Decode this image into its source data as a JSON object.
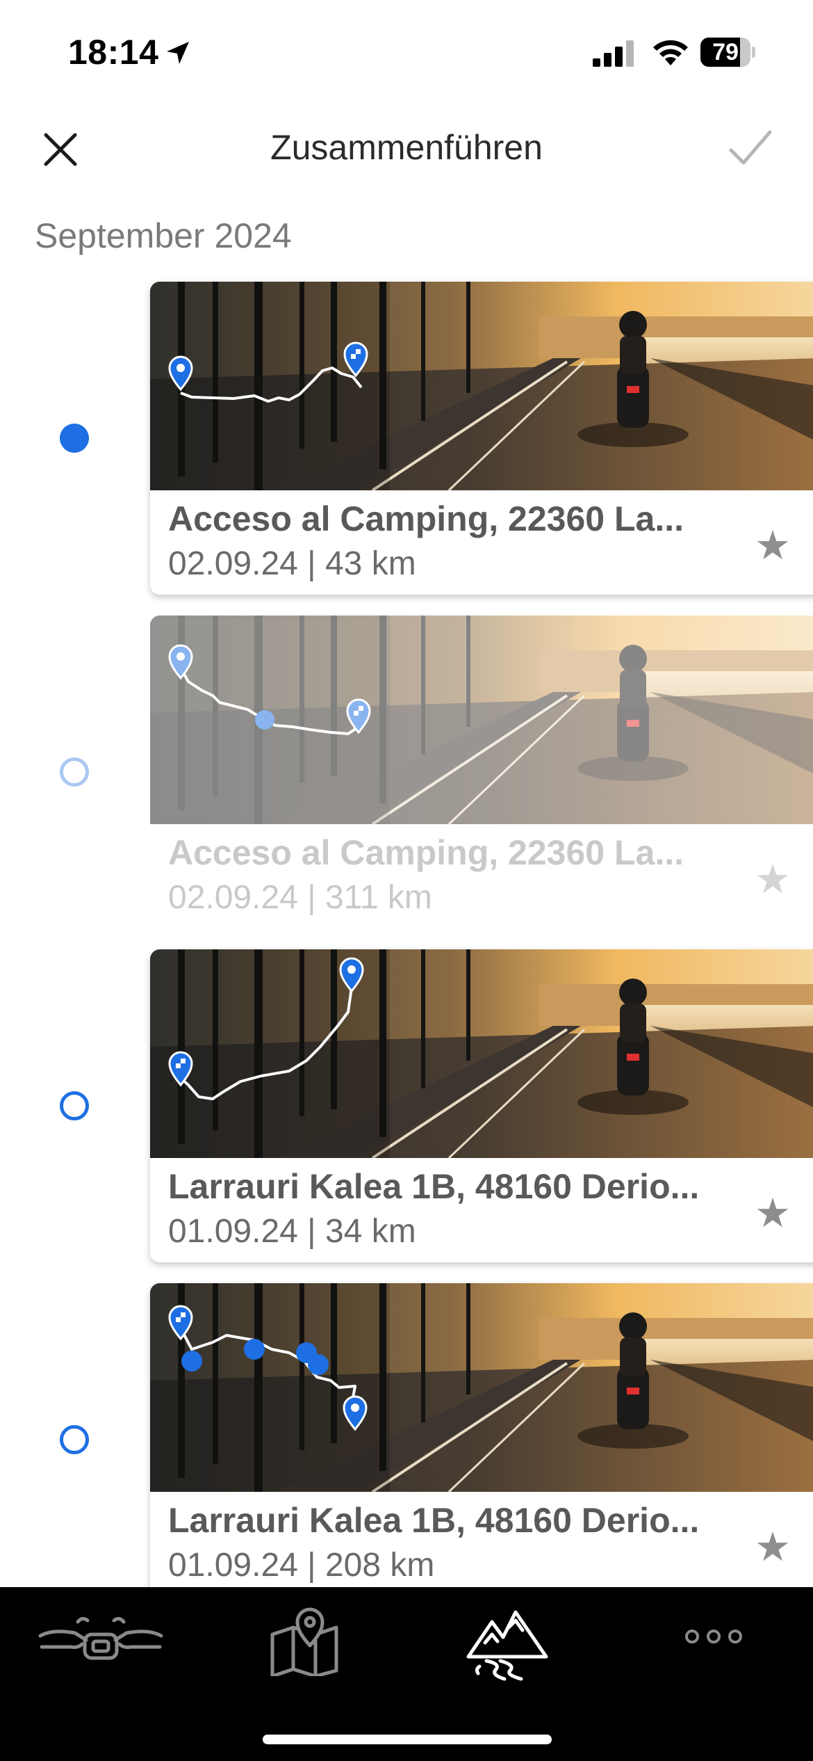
{
  "status": {
    "time": "18:14",
    "battery": "79",
    "battery_level": 0.79
  },
  "header": {
    "title": "Zusammenführen",
    "close_icon": "close-icon",
    "confirm_icon": "checkmark-icon"
  },
  "section": "September 2024",
  "trips": [
    {
      "name": "Acceso al Camping, 22360 La...",
      "meta": "02.09.24 | 43 km",
      "selected": true,
      "enabled": true
    },
    {
      "name": "Acceso al Camping, 22360 La...",
      "meta": "02.09.24 | 311 km",
      "selected": false,
      "enabled": false
    },
    {
      "name": "Larrauri Kalea 1B, 48160 Derio...",
      "meta": "01.09.24 | 34 km",
      "selected": false,
      "enabled": true
    },
    {
      "name": "Larrauri Kalea 1B, 48160 Derio...",
      "meta": "01.09.24 | 208 km",
      "selected": false,
      "enabled": true
    }
  ],
  "tabs": [
    {
      "icon": "motorcycle-handlebar-icon",
      "active": false
    },
    {
      "icon": "map-pin-icon",
      "active": false
    },
    {
      "icon": "mountain-road-icon",
      "active": true
    },
    {
      "icon": "more-dots-icon",
      "active": false
    }
  ],
  "colors": {
    "accent": "#1e6fe3",
    "tab_active": "#ffffff",
    "tab_inactive": "#8a8a8a"
  }
}
